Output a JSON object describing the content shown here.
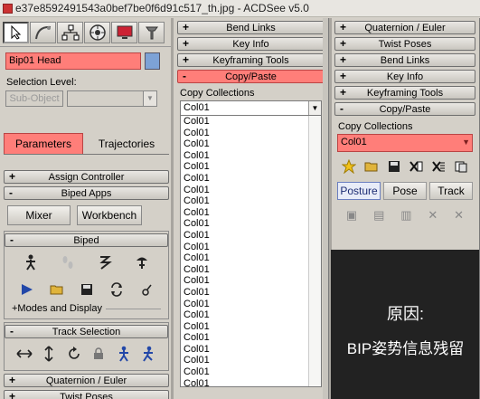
{
  "window": {
    "title": "e37e8592491543a0bef7be0f6d91c517_th.jpg - ACDSee v5.0"
  },
  "left": {
    "command_icons": [
      "pointer-icon",
      "curve-icon",
      "hierarchy-icon",
      "motion-icon",
      "display-icon",
      "utilities-icon"
    ],
    "object_name": "Bip01 Head",
    "selection_level_label": "Selection Level:",
    "sub_object_label": "Sub-Object",
    "tabs": {
      "parameters": "Parameters",
      "trajectories": "Trajectories"
    },
    "rollouts": {
      "assign_controller": "Assign Controller",
      "biped_apps": "Biped Apps",
      "biped": "Biped",
      "track_selection": "Track Selection",
      "quaternion_euler": "Quaternion / Euler",
      "twist_poses": "Twist Poses"
    },
    "buttons": {
      "mixer": "Mixer",
      "workbench": "Workbench"
    },
    "modes_label": "+Modes and Display"
  },
  "middle": {
    "rollouts": {
      "bend_links": "Bend Links",
      "key_info": "Key Info",
      "keyframing_tools": "Keyframing Tools",
      "copy_paste": "Copy/Paste"
    },
    "copy_collections_label": "Copy Collections",
    "dropdown_value": "Col01",
    "list_items": [
      "Col01",
      "Col01",
      "Col01",
      "Col01",
      "Col01",
      "Col01",
      "Col01",
      "Col01",
      "Col01",
      "Col01",
      "Col01",
      "Col01",
      "Col01",
      "Col01",
      "Col01",
      "Col01",
      "Col01",
      "Col01",
      "Col01",
      "Col01",
      "Col01",
      "Col01",
      "Col01",
      "Col01"
    ]
  },
  "right": {
    "rollouts": {
      "quaternion_euler": "Quaternion / Euler",
      "twist_poses": "Twist Poses",
      "bend_links": "Bend Links",
      "key_info": "Key Info",
      "keyframing_tools": "Keyframing Tools",
      "copy_paste": "Copy/Paste"
    },
    "copy_collections_label": "Copy Collections",
    "dropdown_value": "Col01",
    "tabs": {
      "posture": "Posture",
      "pose": "Pose",
      "track": "Track"
    },
    "overlay": {
      "line1": "原因:",
      "line2": "BIP姿势信息残留"
    }
  }
}
